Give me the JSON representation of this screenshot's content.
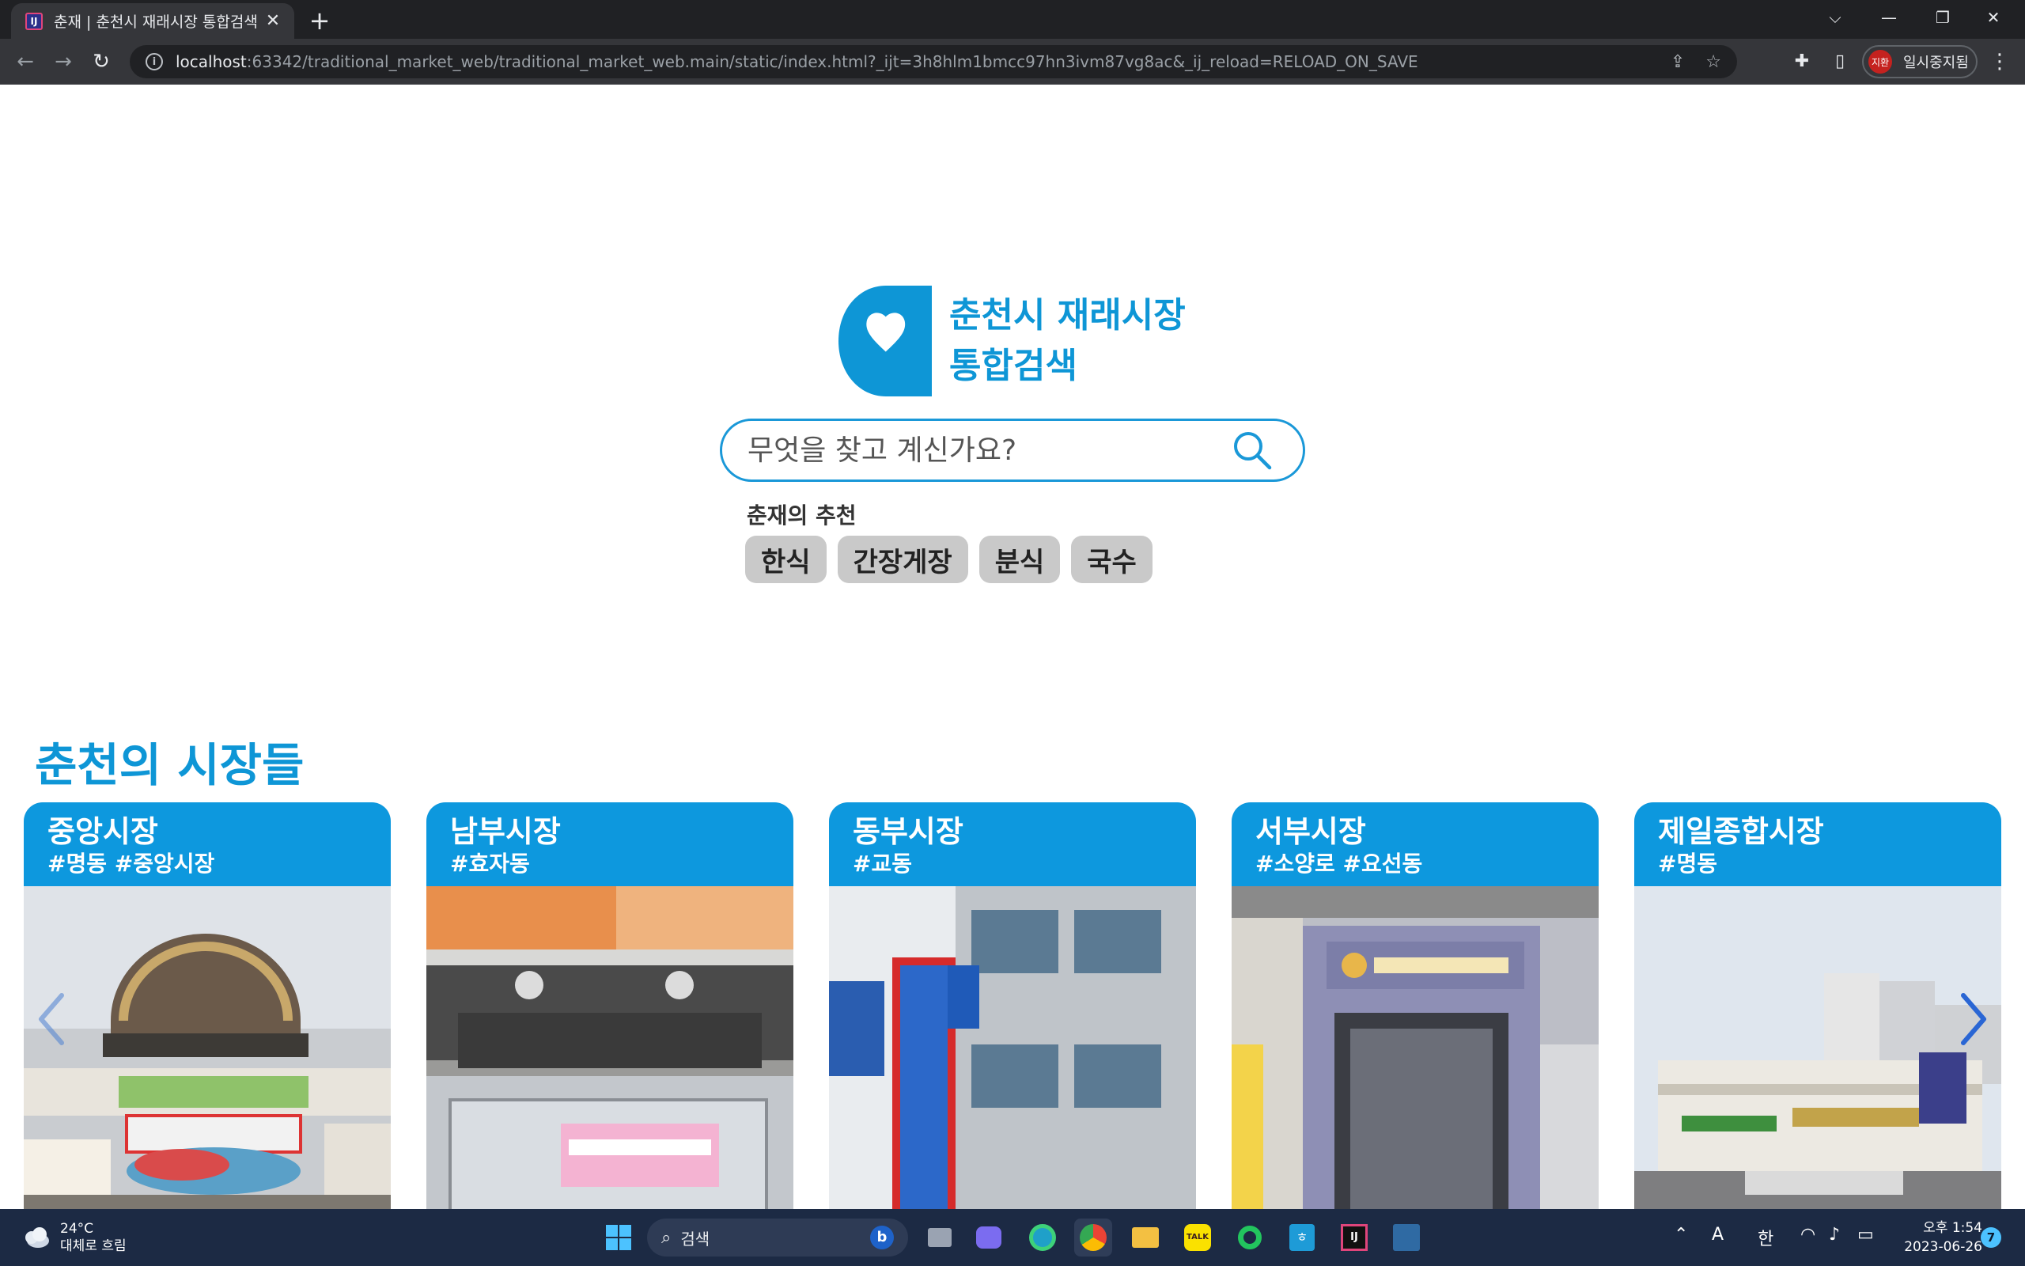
{
  "browser": {
    "tab_title": "춘재 | 춘천시 재래시장 통합검색",
    "tab_favicon_text": "IJ",
    "url_host": "localhost",
    "url_path": ":63342/traditional_market_web/traditional_market_web.main/static/index.html?_ijt=3h8hlm1bmcc97hn3ivm87vg8ac&_ij_reload=RELOAD_ON_SAVE",
    "profile_avatar": "지환",
    "profile_label": "일시중지됨"
  },
  "page": {
    "logo_line1": "춘천시 재래시장",
    "logo_line2": "통합검색",
    "search_placeholder": "무엇을 찾고 계신가요?",
    "recommend_title": "춘재의 추천",
    "chips": [
      "한식",
      "간장게장",
      "분식",
      "국수"
    ],
    "markets_heading": "춘천의 시장들",
    "accent_color": "#0d98de",
    "markets": [
      {
        "name": "중앙시장",
        "tags": "#명동 #중앙시장"
      },
      {
        "name": "남부시장",
        "tags": "#효자동"
      },
      {
        "name": "동부시장",
        "tags": "#교동"
      },
      {
        "name": "서부시장",
        "tags": "#소양로 #요선동"
      },
      {
        "name": "제일종합시장",
        "tags": "#명동"
      }
    ]
  },
  "taskbar": {
    "temperature": "24°C",
    "weather": "대체로 흐림",
    "search_label": "검색",
    "ime_a": "A",
    "ime_han": "한",
    "time": "오후 1:54",
    "date": "2023-06-26",
    "notification_count": "7"
  }
}
